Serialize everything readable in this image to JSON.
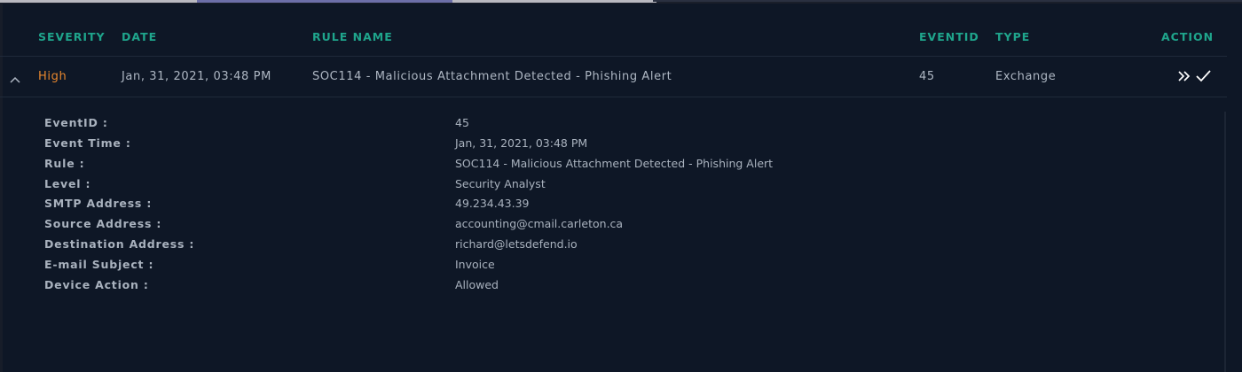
{
  "columns": {
    "severity": "SEVERITY",
    "date": "DATE",
    "rule_name": "RULE NAME",
    "eventid": "EVENTID",
    "type": "TYPE",
    "action": "ACTION"
  },
  "alert": {
    "severity": "High",
    "date": "Jan, 31, 2021, 03:48 PM",
    "rule_name": "SOC114 - Malicious Attachment Detected - Phishing Alert",
    "eventid": "45",
    "type": "Exchange",
    "action_icons": [
      "double-chevron-right-icon",
      "checkmark-icon"
    ],
    "expand_icon": "chevron-up-icon"
  },
  "details": [
    {
      "label": "EventID :",
      "value": "45"
    },
    {
      "label": "Event Time :",
      "value": "Jan, 31, 2021, 03:48 PM"
    },
    {
      "label": "Rule :",
      "value": "SOC114 - Malicious Attachment Detected - Phishing Alert"
    },
    {
      "label": "Level :",
      "value": "Security Analyst"
    },
    {
      "label": "SMTP Address :",
      "value": "49.234.43.39"
    },
    {
      "label": "Source Address :",
      "value": "accounting@cmail.carleton.ca"
    },
    {
      "label": "Destination Address :",
      "value": "richard@letsdefend.io"
    },
    {
      "label": "E-mail Subject :",
      "value": "Invoice"
    },
    {
      "label": "Device Action :",
      "value": "Allowed"
    }
  ],
  "colors": {
    "background": "#0e1726",
    "header_text": "#1fa58c",
    "severity_high": "#e8872e",
    "body_text": "#aeb7c3",
    "divider": "#1f2a3a"
  }
}
